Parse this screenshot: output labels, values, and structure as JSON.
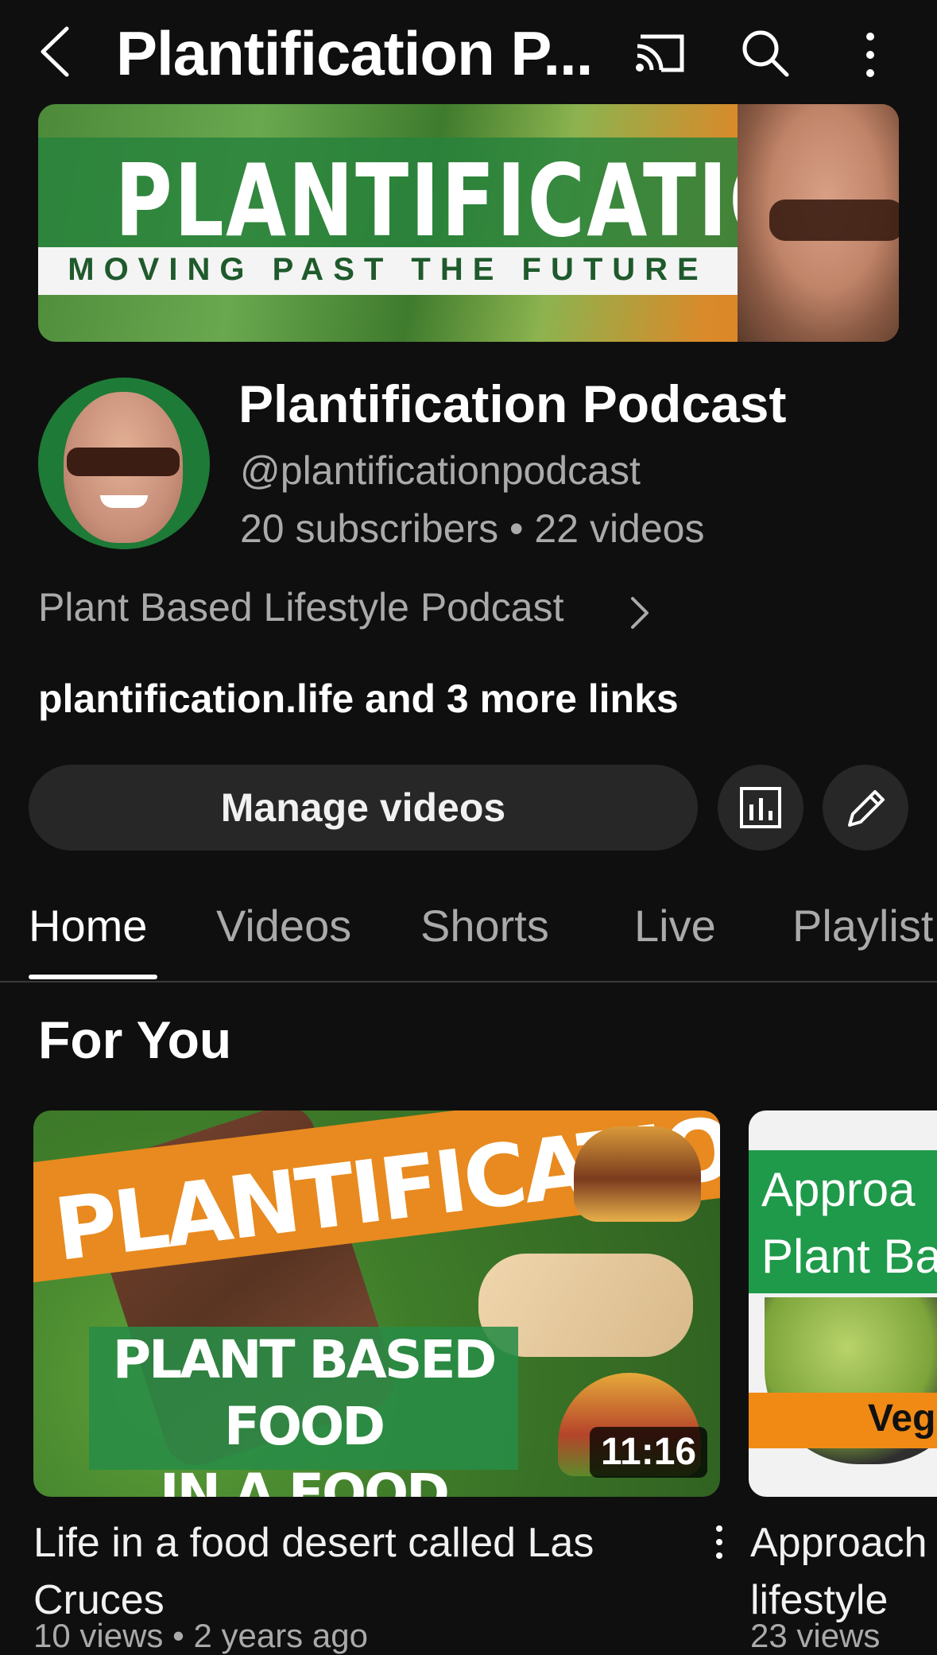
{
  "header": {
    "title": "Plantification P...",
    "back_icon": "chevron-left-icon",
    "cast_icon": "cast-icon",
    "search_icon": "search-icon",
    "more_icon": "more-vertical-icon"
  },
  "banner": {
    "title": "PLANTIFICATION",
    "tagline": "MOVING PAST THE FUTURE"
  },
  "channel": {
    "name": "Plantification Podcast",
    "handle": "@plantificationpodcast",
    "stats": "20 subscribers • 22 videos",
    "category": "Plant Based Lifestyle Podcast",
    "links": "plantification.life and 3 more links"
  },
  "actions": {
    "manage_label": "Manage videos",
    "analytics_icon": "analytics-icon",
    "edit_icon": "pencil-icon"
  },
  "tabs": [
    "Home",
    "Videos",
    "Shorts",
    "Live",
    "Playlist"
  ],
  "active_tab": "Home",
  "section": {
    "title": "For You"
  },
  "videos": [
    {
      "thumb_brand": "PLANTIFICATION",
      "thumb_line1": "PLANT BASED FOOD",
      "thumb_line2": "IN A FOOD DESERT",
      "duration": "11:16",
      "title": "Life in a food desert called Las Cruces",
      "meta": "10 views • 2 years ago"
    },
    {
      "thumb_line1": "Approa",
      "thumb_line2": "Plant Ba",
      "thumb_badge": "Veg",
      "title_line1": "Approach",
      "title_line2": "lifestyle",
      "meta": "23 views"
    }
  ],
  "colors": {
    "background": "#0f0f0f",
    "button_bg": "#272727",
    "text_secondary": "#aaaaaa"
  }
}
